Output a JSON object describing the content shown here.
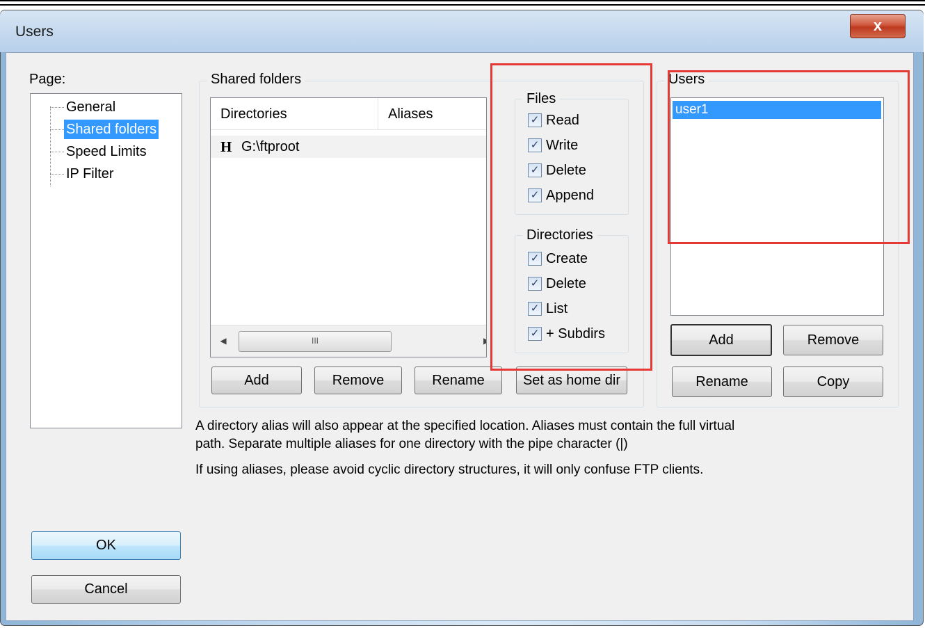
{
  "window": {
    "title": "Users",
    "close_glyph": "x"
  },
  "page_panel": {
    "label": "Page:",
    "items": [
      {
        "label": "General",
        "selected": false
      },
      {
        "label": "Shared folders",
        "selected": true
      },
      {
        "label": "Speed Limits",
        "selected": false
      },
      {
        "label": "IP Filter",
        "selected": false
      }
    ]
  },
  "shared_folders": {
    "group_title": "Shared folders",
    "columns": [
      "Directories",
      "Aliases"
    ],
    "rows": [
      {
        "icon": "H",
        "path": "G:\\ftproot",
        "alias": ""
      }
    ],
    "scroll_grip": "III",
    "buttons": {
      "add": "Add",
      "remove": "Remove",
      "rename": "Rename",
      "set_home": "Set as home dir"
    }
  },
  "permissions": {
    "files_title": "Files",
    "files": [
      {
        "label": "Read",
        "checked": true
      },
      {
        "label": "Write",
        "checked": true
      },
      {
        "label": "Delete",
        "checked": true
      },
      {
        "label": "Append",
        "checked": true
      }
    ],
    "dirs_title": "Directories",
    "dirs": [
      {
        "label": "Create",
        "checked": true
      },
      {
        "label": "Delete",
        "checked": true
      },
      {
        "label": "List",
        "checked": true
      },
      {
        "label": "+ Subdirs",
        "checked": true
      }
    ],
    "check_glyph": "✓"
  },
  "users": {
    "group_title": "Users",
    "list": [
      "user1"
    ],
    "buttons": {
      "add": "Add",
      "remove": "Remove",
      "rename": "Rename",
      "copy": "Copy"
    }
  },
  "info": {
    "alias_line1": "A directory alias will also appear at the specified location. Aliases must contain the full virtual",
    "alias_line2": "path. Separate multiple aliases for one directory with the pipe character (|)",
    "cyclic_note": "If using aliases, please avoid cyclic directory structures, it will only confuse FTP clients."
  },
  "dialog_buttons": {
    "ok": "OK",
    "cancel": "Cancel"
  },
  "colors": {
    "selection": "#3399ff",
    "highlight_annotation": "#e53935",
    "client_bg": "#f0f0f0"
  }
}
